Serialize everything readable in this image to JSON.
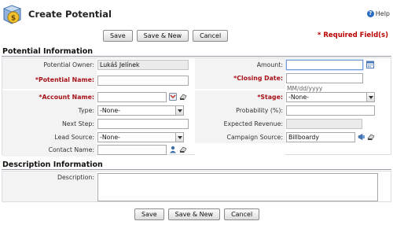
{
  "header": {
    "title": "Create Potential",
    "help_label": "Help"
  },
  "toolbar": {
    "save_label": "Save",
    "save_new_label": "Save & New",
    "cancel_label": "Cancel"
  },
  "required_note": "* Required Field(s)",
  "sections": {
    "potential_info": "Potential Information",
    "description_info": "Description Information"
  },
  "fields": {
    "potential_owner": {
      "label": "Potential Owner:",
      "value": "Lukáš Jelínek"
    },
    "potential_name": {
      "label": "*Potential Name:",
      "value": ""
    },
    "account_name": {
      "label": "*Account Name:",
      "value": ""
    },
    "type": {
      "label": "Type:",
      "value": "-None-"
    },
    "next_step": {
      "label": "Next Step:",
      "value": ""
    },
    "lead_source": {
      "label": "Lead Source:",
      "value": "-None-"
    },
    "contact_name": {
      "label": "Contact Name:",
      "value": ""
    },
    "amount": {
      "label": "Amount:",
      "value": ""
    },
    "closing_date": {
      "label": "*Closing Date:",
      "value": "",
      "hint": "MM/dd/yyyy"
    },
    "stage": {
      "label": "*Stage:",
      "value": "-None-"
    },
    "probability": {
      "label": "Probability (%):",
      "value": ""
    },
    "expected_revenue": {
      "label": "Expected Revenue:",
      "value": ""
    },
    "campaign_source": {
      "label": "Campaign Source:",
      "value": "Billboardy"
    },
    "description": {
      "label": "Description:",
      "value": ""
    }
  },
  "icons": {
    "logo": "potential-money-icon",
    "help": "help-icon",
    "calendar": "calendar-icon",
    "lookup": "lookup-icon",
    "clear": "clear-icon",
    "add_contact": "add-contact-icon"
  },
  "colors": {
    "required": "#a8131a",
    "section_line": "#9aa0aa",
    "label_bg": "#f3f3f3"
  }
}
